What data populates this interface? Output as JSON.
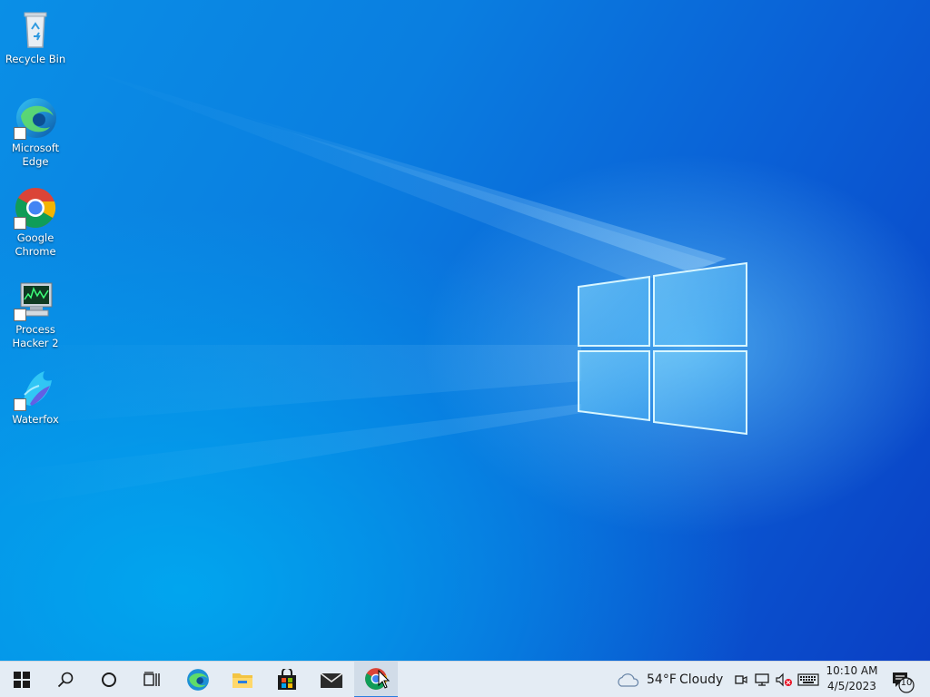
{
  "desktop": {
    "icons": [
      {
        "label_line1": "Recycle Bin",
        "label_line2": "",
        "icon": "recycle-bin-icon"
      },
      {
        "label_line1": "Microsoft",
        "label_line2": "Edge",
        "icon": "edge-icon"
      },
      {
        "label_line1": "Google",
        "label_line2": "Chrome",
        "icon": "chrome-icon"
      },
      {
        "label_line1": "Process",
        "label_line2": "Hacker 2",
        "icon": "process-hacker-icon"
      },
      {
        "label_line1": "Waterfox",
        "label_line2": "",
        "icon": "waterfox-icon"
      }
    ]
  },
  "taskbar": {
    "buttons": [
      {
        "name": "start",
        "icon": "windows-icon"
      },
      {
        "name": "search",
        "icon": "search-icon"
      },
      {
        "name": "cortana",
        "icon": "cortana-circle-icon"
      },
      {
        "name": "task-view",
        "icon": "task-view-icon"
      },
      {
        "name": "edge",
        "icon": "edge-icon"
      },
      {
        "name": "file-explorer",
        "icon": "folder-icon"
      },
      {
        "name": "store",
        "icon": "store-bag-icon"
      },
      {
        "name": "mail",
        "icon": "mail-icon"
      },
      {
        "name": "chrome",
        "icon": "chrome-icon",
        "active": true
      }
    ],
    "weather": {
      "temperature": "54°F",
      "condition": "Cloudy",
      "icon": "cloud-icon"
    },
    "tray_icons": [
      "meet-now-icon",
      "network-icon",
      "volume-muted-icon",
      "keyboard-icon"
    ],
    "clock": {
      "time": "10:10 AM",
      "date": "4/5/2023"
    },
    "notifications": {
      "count": "10",
      "icon": "action-center-icon"
    }
  },
  "colors": {
    "accent": "#2a7de0",
    "taskbar_bg": "#e4ecf4",
    "desktop_blue": "#0a7ee0"
  }
}
